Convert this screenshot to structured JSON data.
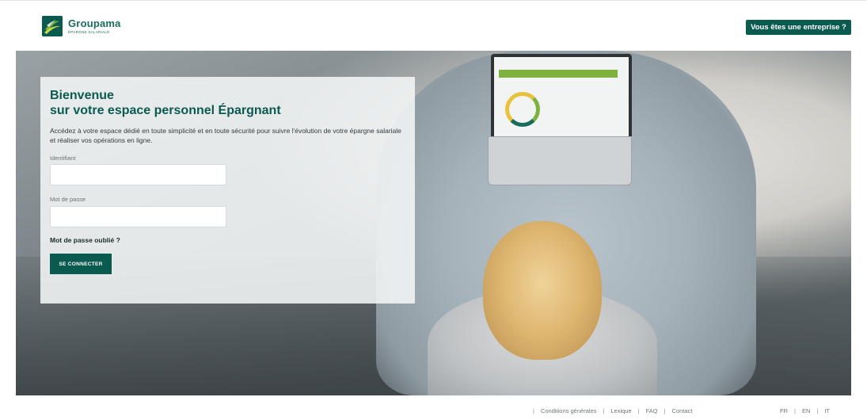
{
  "header": {
    "logo_name": "Groupama",
    "logo_sub": "ÉPARGNE SALARIALE",
    "enterprise_button": "Vous êtes une entreprise ?"
  },
  "login": {
    "title_line1": "Bienvenue",
    "title_line2": "sur votre espace personnel Épargnant",
    "intro": "Accédez à votre espace dédié en toute simplicité et en toute sécurité pour suivre l'évolution de votre épargne salariale et réaliser vos opérations en ligne.",
    "identifiant_label": "Identifiant",
    "identifiant_value": "",
    "password_label": "Mot de passe",
    "password_value": "",
    "forgot_password": "Mot de passe oublié ?",
    "connect_button": "SE CONNECTER"
  },
  "footer": {
    "links": [
      "Conditions générales",
      "Lexique",
      "FAQ",
      "Contact"
    ],
    "languages": [
      "FR",
      "EN",
      "IT"
    ],
    "separator": "|"
  },
  "colors": {
    "brand_green": "#0b5a50",
    "accent_green": "#7fb13f"
  }
}
